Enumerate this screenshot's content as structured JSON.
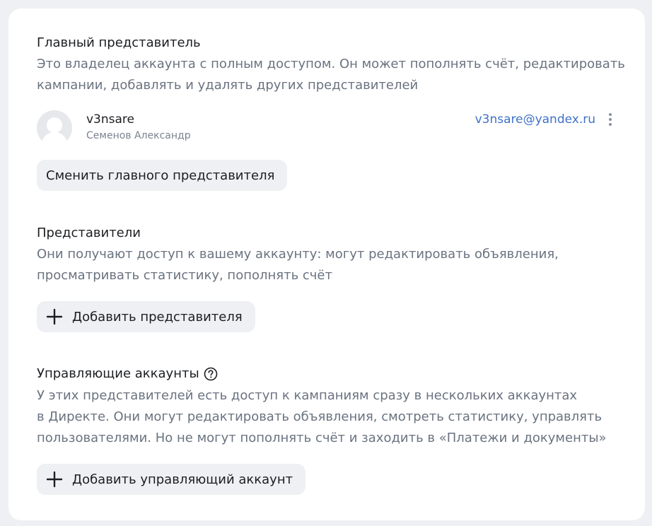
{
  "main_rep": {
    "title": "Главный представитель",
    "desc": [
      "Это владелец аккаунта с полным доступом. Он может пополнять счёт, редактировать",
      "кампании, добавлять и удалять других представителей"
    ],
    "user": {
      "login": "v3nsare",
      "name": "Семенов Александр",
      "email": "v3nsare@yandex.ru"
    },
    "change_button": "Сменить главного представителя"
  },
  "reps": {
    "title": "Представители",
    "desc": [
      "Они получают доступ к вашему аккаунту: могут редактировать объявления,",
      "просматривать статистику, пополнять счёт"
    ],
    "add_button": "Добавить представителя"
  },
  "managing": {
    "title": "Управляющие аккаунты",
    "desc": [
      "У этих представителей есть доступ к кампаниям сразу в нескольких аккаунтах",
      "в Директе. Они могут редактировать объявления, смотреть статистику, управлять",
      "пользователями. Но не могут пополнять счёт и заходить в «Платежи и документы»"
    ],
    "add_button": "Добавить управляющий аккаунт"
  },
  "colors": {
    "accent_link": "#3e72c8",
    "muted_text": "#6a7380",
    "button_bg": "#eef0f3"
  }
}
